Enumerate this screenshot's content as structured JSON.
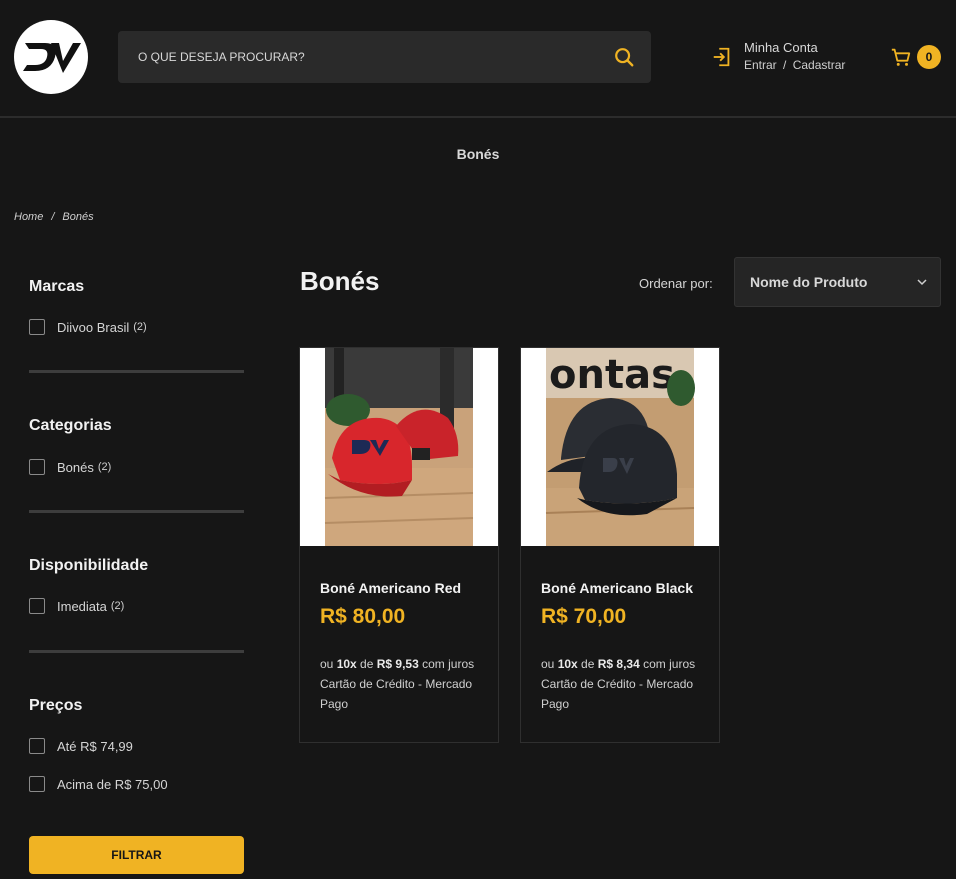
{
  "header": {
    "logo_text": "DV",
    "search": {
      "placeholder": "O QUE DESEJA PROCURAR?",
      "icon": "search-icon"
    },
    "account": {
      "title": "Minha Conta",
      "login": "Entrar",
      "separator": "/",
      "register": "Cadastrar",
      "icon": "login-icon"
    },
    "cart": {
      "count": "0",
      "icon": "cart-icon"
    }
  },
  "page": {
    "heading": "Bonés"
  },
  "breadcrumb": {
    "home": "Home",
    "separator": "/",
    "current": "Bonés"
  },
  "filters": {
    "brands": {
      "title": "Marcas",
      "options": [
        {
          "label": "Diivoo Brasil",
          "count": "(2)"
        }
      ]
    },
    "categories": {
      "title": "Categorias",
      "options": [
        {
          "label": "Bonés",
          "count": "(2)"
        }
      ]
    },
    "availability": {
      "title": "Disponibilidade",
      "options": [
        {
          "label": "Imediata",
          "count": "(2)"
        }
      ]
    },
    "prices": {
      "title": "Preços",
      "options": [
        {
          "label": "Até R$ 74,99"
        },
        {
          "label": "Acima de R$ 75,00"
        }
      ]
    },
    "button": "FILTRAR"
  },
  "listing": {
    "title": "Bonés",
    "sort_label": "Ordenar por:",
    "sort_value": "Nome do Produto"
  },
  "products": [
    {
      "name": "Boné Americano Red",
      "price": "R$ 80,00",
      "inst_prefix": "ou ",
      "inst_count": "10x",
      "inst_mid": " de ",
      "inst_value": "R$ 9,53",
      "inst_suffix": " com juros Cartão de Crédito - Mercado Pago",
      "cap_color": "#d8262c"
    },
    {
      "name": "Boné Americano Black",
      "price": "R$ 70,00",
      "inst_prefix": "ou ",
      "inst_count": "10x",
      "inst_mid": " de ",
      "inst_value": "R$ 8,34",
      "inst_suffix": " com juros Cartão de Crédito - Mercado Pago",
      "cap_color": "#23262c"
    }
  ],
  "colors": {
    "accent": "#f0b323",
    "background": "#161616",
    "panel": "#2a2a2a"
  }
}
